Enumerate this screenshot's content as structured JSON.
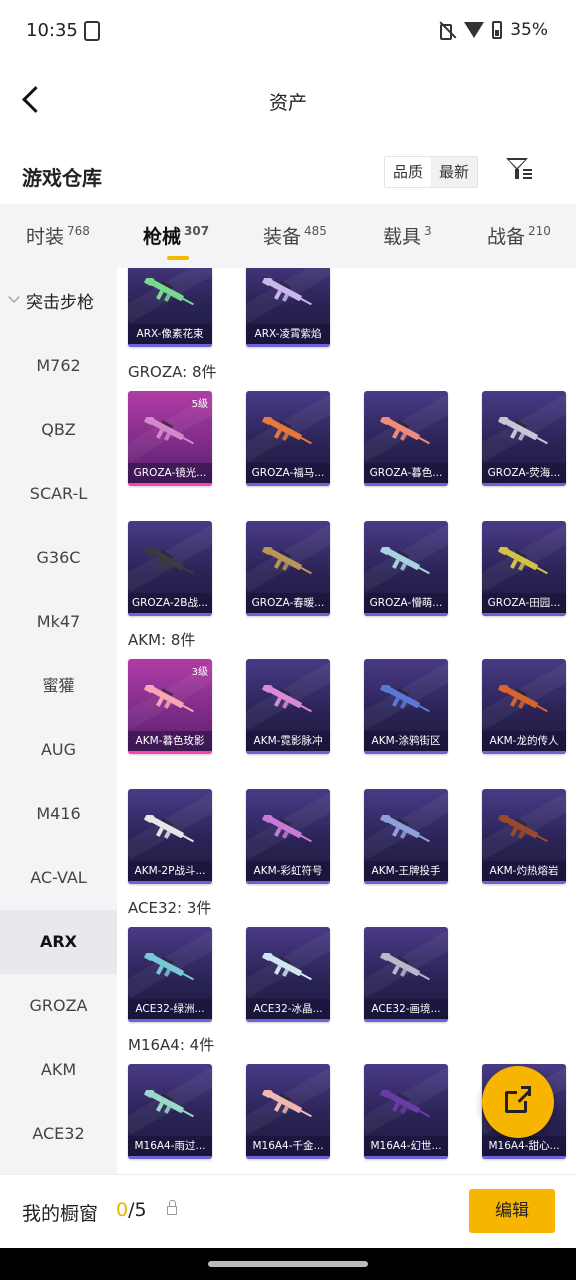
{
  "status_bar": {
    "time": "10:35",
    "battery": "35%"
  },
  "header": {
    "title": "资产"
  },
  "section": {
    "title": "游戏仓库",
    "sort_options": [
      "品质",
      "最新"
    ]
  },
  "tabs": [
    {
      "label": "时装",
      "count": "768"
    },
    {
      "label": "枪械",
      "count": "307"
    },
    {
      "label": "装备",
      "count": "485"
    },
    {
      "label": "载具",
      "count": "3"
    },
    {
      "label": "战备",
      "count": "210"
    }
  ],
  "sidebar": {
    "header": "突击步枪",
    "items": [
      "M762",
      "QBZ",
      "SCAR-L",
      "G36C",
      "Mk47",
      "蜜獾",
      "AUG",
      "M416",
      "AC-VAL",
      "ARX",
      "GROZA",
      "AKM",
      "ACE32"
    ]
  },
  "groups": {
    "arx": {
      "items": [
        "ARX-像素花束",
        "ARX-凌霄紫焰"
      ]
    },
    "groza": {
      "label": "GROZA: 8件",
      "items": [
        "GROZA-镜光...",
        "GROZA-福马...",
        "GROZA-暮色...",
        "GROZA-荧海...",
        "GROZA-2B战...",
        "GROZA-春暖...",
        "GROZA-懵萌...",
        "GROZA-田园..."
      ],
      "level": "5级"
    },
    "akm": {
      "label": "AKM: 8件",
      "items": [
        "AKM-暮色玫影",
        "AKM-霓影脉冲",
        "AKM-涂鸦街区",
        "AKM-龙的传人",
        "AKM-2P战斗...",
        "AKM-彩虹符号",
        "AKM-王牌投手",
        "AKM-灼热熔岩"
      ],
      "level": "3级"
    },
    "ace32": {
      "label": "ACE32: 3件",
      "items": [
        "ACE32-绿洲...",
        "ACE32-冰晶...",
        "ACE32-画境..."
      ]
    },
    "m16a4": {
      "label": "M16A4: 4件",
      "items": [
        "M16A4-雨过...",
        "M16A4-千金...",
        "M16A4-幻世...",
        "M16A4-甜心..."
      ]
    }
  },
  "bottom": {
    "showcase_label": "我的橱窗",
    "count_current": "0",
    "count_total": "/5",
    "edit_label": "编辑"
  },
  "colors": {
    "accent": "#f5b800",
    "card_bg": "#2a2355",
    "card_rare": "#b03ca6"
  },
  "icons": [
    "back-arrow-icon",
    "filter-icon",
    "share-icon",
    "lock-icon",
    "chevron-down-icon"
  ]
}
